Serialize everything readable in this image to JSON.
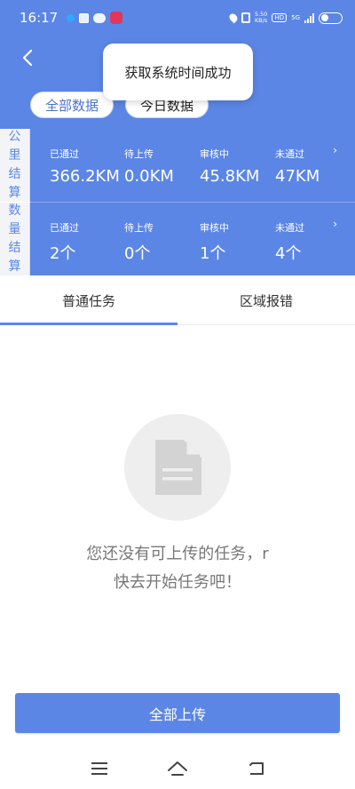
{
  "status_bar": {
    "time": "16:17",
    "net_speed_value": "5.50",
    "net_speed_unit": "KB/s",
    "hd": "HD",
    "network": "5G"
  },
  "toast": {
    "message": "获取系统时间成功"
  },
  "filters": {
    "all_label": "全部数据",
    "today_label": "今日数据"
  },
  "km_row": {
    "label": [
      "公",
      "里",
      "结",
      "算"
    ],
    "stats": [
      {
        "title": "已通过",
        "value": "366.2KM"
      },
      {
        "title": "待上传",
        "value": "0.0KM"
      },
      {
        "title": "审核中",
        "value": "45.8KM"
      },
      {
        "title": "未通过",
        "value": "47KM"
      }
    ],
    "arrow": "›"
  },
  "count_row": {
    "label": [
      "数",
      "量",
      "结",
      "算"
    ],
    "stats": [
      {
        "title": "已通过",
        "value": "2个"
      },
      {
        "title": "待上传",
        "value": "0个"
      },
      {
        "title": "审核中",
        "value": "1个"
      },
      {
        "title": "未通过",
        "value": "4个"
      }
    ],
    "arrow": "›"
  },
  "tabs": [
    {
      "label": "普通任务",
      "active": true
    },
    {
      "label": "区域报错",
      "active": false
    }
  ],
  "empty_state": {
    "icon": "document-icon",
    "line1": "您还没有可上传的任务，r",
    "line2": "快去开始任务吧！"
  },
  "upload_button": {
    "label": "全部上传"
  },
  "colors": {
    "primary": "#5b86e5",
    "background": "#ffffff",
    "empty_circle": "#eeeeee"
  }
}
